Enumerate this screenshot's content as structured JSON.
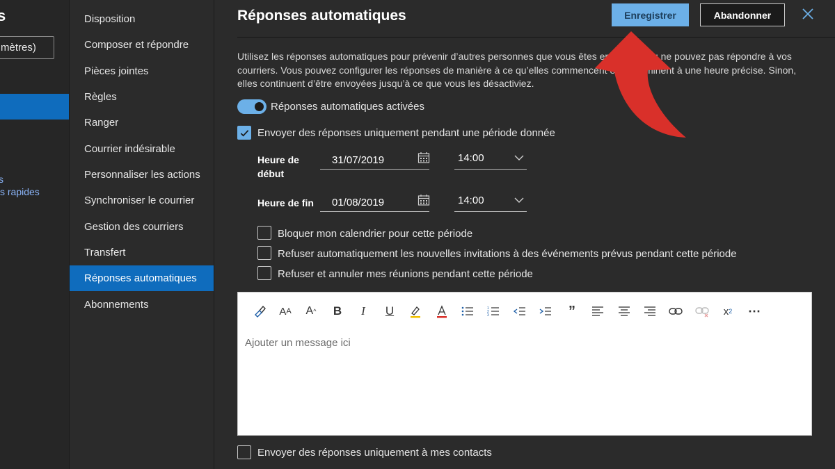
{
  "left_panel": {
    "title_fragment": "s",
    "button_fragment": "mètres)",
    "link_fragment_1": "s",
    "link_fragment_2": "s rapides"
  },
  "nav": {
    "items": [
      {
        "label": "Disposition"
      },
      {
        "label": "Composer et répondre"
      },
      {
        "label": "Pièces jointes"
      },
      {
        "label": "Règles"
      },
      {
        "label": "Ranger"
      },
      {
        "label": "Courrier indésirable"
      },
      {
        "label": "Personnaliser les actions"
      },
      {
        "label": "Synchroniser le courrier"
      },
      {
        "label": "Gestion des courriers"
      },
      {
        "label": "Transfert"
      },
      {
        "label": "Réponses automatiques",
        "active": true
      },
      {
        "label": "Abonnements"
      }
    ]
  },
  "header": {
    "title": "Réponses automatiques",
    "save_label": "Enregistrer",
    "discard_label": "Abandonner",
    "close_icon": "close-icon"
  },
  "intro": {
    "text": "Utilisez les réponses automatiques pour prévenir d’autres personnes que vous êtes en congés ou ne pouvez pas répondre à vos courriers. Vous pouvez configurer les réponses de manière à ce qu’elles commencent et se terminent à une heure précise. Sinon, elles continuent d’être envoyées jusqu’à ce que vous les désactiviez."
  },
  "toggle": {
    "label": "Réponses automatiques activées",
    "on": true
  },
  "period_checkbox": {
    "label": "Envoyer des réponses uniquement pendant une période donnée",
    "checked": true
  },
  "start": {
    "label_line1": "Heure de",
    "label_line2": "début",
    "date": "31/07/2019",
    "time": "14:00"
  },
  "end": {
    "label": "Heure de fin",
    "date": "01/08/2019",
    "time": "14:00"
  },
  "options": [
    {
      "label": "Bloquer mon calendrier pour cette période",
      "checked": false
    },
    {
      "label": "Refuser automatiquement les nouvelles invitations à des événements prévus pendant cette période",
      "checked": false
    },
    {
      "label": "Refuser et annuler mes réunions pendant cette période",
      "checked": false
    }
  ],
  "editor": {
    "placeholder": "Ajouter un message ici",
    "toolbar_icons": [
      "format-painter-icon",
      "font-size-icon",
      "font-grow-icon",
      "bold-icon",
      "italic-icon",
      "underline-icon",
      "highlight-icon",
      "font-color-icon",
      "bullets-icon",
      "numbering-icon",
      "decrease-indent-icon",
      "increase-indent-icon",
      "quote-icon",
      "align-left-icon",
      "align-center-icon",
      "align-right-icon",
      "link-icon",
      "unlink-icon",
      "superscript-icon",
      "more-icon"
    ]
  },
  "contacts_checkbox": {
    "label": "Envoyer des réponses uniquement à mes contacts",
    "checked": false
  },
  "colors": {
    "accent": "#0f6cbd",
    "save_button": "#6cb0e8",
    "annotation_arrow": "#d9302a"
  }
}
